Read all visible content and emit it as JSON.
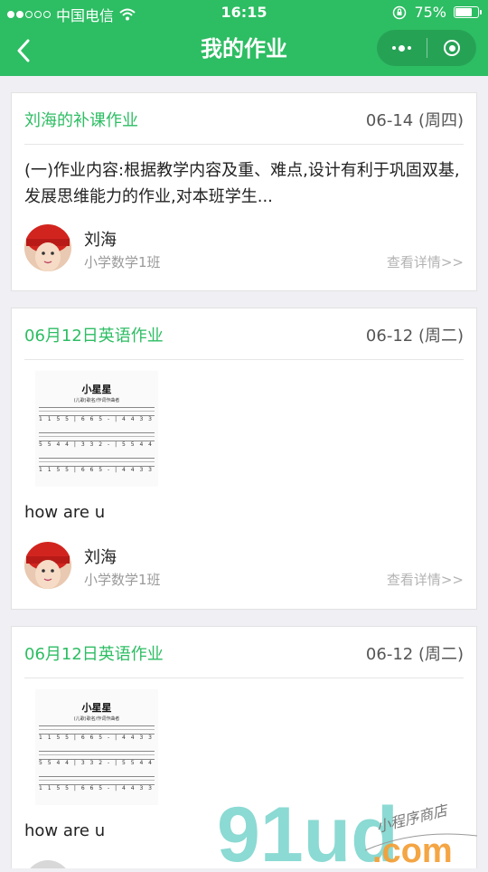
{
  "status_bar": {
    "carrier": "中国电信",
    "time": "16:15",
    "battery": "75%",
    "battery_level": 0.75
  },
  "nav": {
    "title": "我的作业"
  },
  "colors": {
    "accent": "#2dbd63",
    "header_bg": "#2dbd63",
    "page_bg": "#efeff4"
  },
  "cards": [
    {
      "title": "刘海的补课作业",
      "date": "06-14 (周四)",
      "text": "(一)作业内容:根据教学内容及重、难点,设计有利于巩固双基,发展思维能力的作业,对本班学生...",
      "author": "刘海",
      "class_name": "小学数学1班",
      "detail": "查看详情>>"
    },
    {
      "title": "06月12日英语作业",
      "date": "06-12 (周二)",
      "image": {
        "title": "小星星",
        "subtitle": "(儿歌)歌名/作词作曲者"
      },
      "text": "how are u",
      "author": "刘海",
      "class_name": "小学数学1班",
      "detail": "查看详情>>"
    },
    {
      "title": "06月12日英语作业",
      "date": "06-12 (周二)",
      "image": {
        "title": "小星星",
        "subtitle": "(儿歌)歌名/作词作曲者"
      },
      "text": "how are u"
    }
  ],
  "sheet_rows": [
    "1 1 5 5 | 6 6 5 - | 4 4 3 3 | 2 2 1 -",
    "5 5 4 4 | 3 3 2 - | 5 5 4 4 | 3 3 2 -",
    "1 1 5 5 | 6 6 5 - | 4 4 3 3 | 2 2 1 -"
  ],
  "watermark": {
    "logo": "91ud",
    "domain": ".com",
    "slogan": "小程序商店"
  }
}
